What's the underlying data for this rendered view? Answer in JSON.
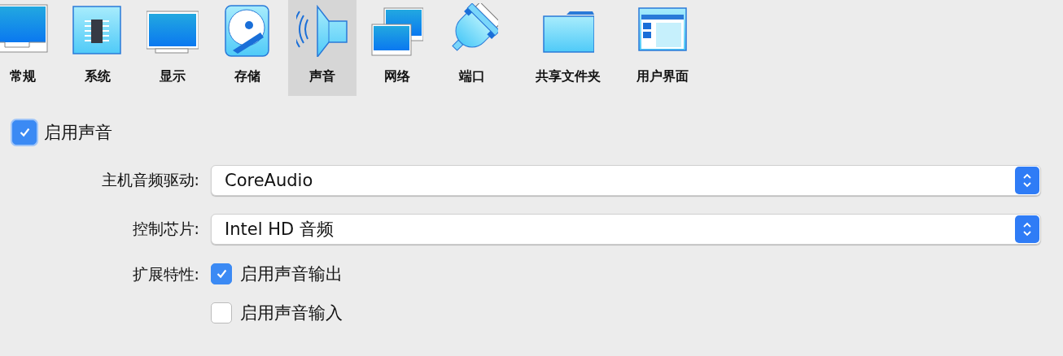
{
  "tabs": [
    {
      "label": "常规",
      "kind": "general",
      "selected": false
    },
    {
      "label": "系统",
      "kind": "system",
      "selected": false
    },
    {
      "label": "显示",
      "kind": "display",
      "selected": false
    },
    {
      "label": "存储",
      "kind": "storage",
      "selected": false
    },
    {
      "label": "声音",
      "kind": "audio",
      "selected": true
    },
    {
      "label": "网络",
      "kind": "network",
      "selected": false
    },
    {
      "label": "端口",
      "kind": "ports",
      "selected": false
    },
    {
      "label": "共享文件夹",
      "kind": "shared-folders",
      "selected": false
    },
    {
      "label": "用户界面",
      "kind": "user-interface",
      "selected": false
    }
  ],
  "enable_audio": {
    "label": "启用声音",
    "checked": true
  },
  "host_audio_driver": {
    "label": "主机音频驱动:",
    "value": "CoreAudio"
  },
  "audio_controller": {
    "label": "控制芯片:",
    "value": "Intel HD 音频"
  },
  "extended_features": {
    "label": "扩展特性:",
    "options": [
      {
        "label": "启用声音输出",
        "checked": true
      },
      {
        "label": "启用声音输入",
        "checked": false
      }
    ]
  }
}
